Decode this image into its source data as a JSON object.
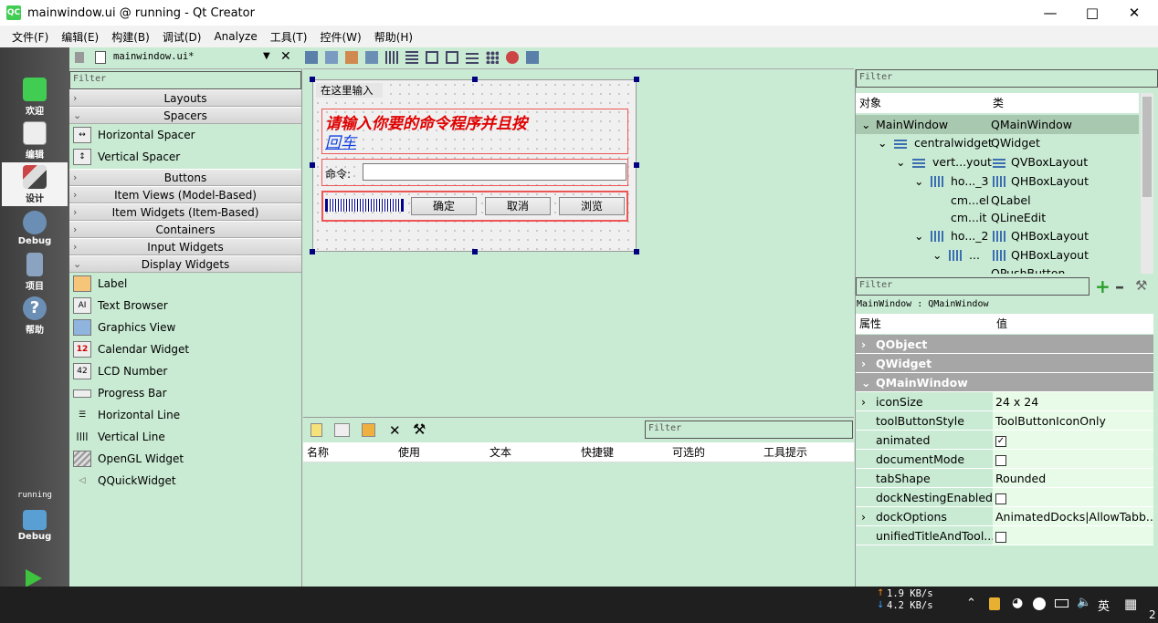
{
  "window": {
    "title": "mainwindow.ui @ running - Qt Creator",
    "logo": "QC"
  },
  "menu": [
    "文件(F)",
    "编辑(E)",
    "构建(B)",
    "调试(D)",
    "Analyze",
    "工具(T)",
    "控件(W)",
    "帮助(H)"
  ],
  "modes": [
    {
      "label": "欢迎",
      "icon": "qt-welcome-icon"
    },
    {
      "label": "编辑",
      "icon": "edit-icon"
    },
    {
      "label": "设计",
      "icon": "design-icon"
    },
    {
      "label": "Debug",
      "icon": "debug-icon"
    },
    {
      "label": "项目",
      "icon": "project-icon"
    },
    {
      "label": "帮助",
      "icon": "help-icon"
    }
  ],
  "run": {
    "kit_label": "running",
    "kit_mode": "Debug"
  },
  "editor": {
    "file_name": "mainwindow.ui*"
  },
  "widgetbox": {
    "filter_placeholder": "Filter",
    "categories_top": [
      "Layouts",
      "Spacers"
    ],
    "spacers": [
      "Horizontal Spacer",
      "Vertical Spacer"
    ],
    "categories_mid": [
      "Buttons",
      "Item Views (Model-Based)",
      "Item Widgets (Item-Based)",
      "Containers",
      "Input Widgets",
      "Display Widgets"
    ],
    "display_widgets": [
      "Label",
      "Text Browser",
      "Graphics View",
      "Calendar Widget",
      "LCD Number",
      "Progress Bar",
      "Horizontal Line",
      "Vertical Line",
      "OpenGL Widget",
      "QQuickWidget"
    ]
  },
  "form": {
    "menu_placeholder": "在这里输入",
    "label_text": "请输入你要的命令程序并且按",
    "label_link": "回车",
    "cmd_label": "命令:",
    "btn_ok": "确定",
    "btn_cancel": "取消",
    "btn_browse": "浏览"
  },
  "actions": {
    "filter_placeholder": "Filter",
    "columns": [
      "名称",
      "使用",
      "文本",
      "快捷键",
      "可选的",
      "工具提示"
    ]
  },
  "inspector": {
    "filter_placeholder": "Filter",
    "col_object": "对象",
    "col_class": "类",
    "rows": [
      {
        "obj": "MainWindow",
        "cls": "QMainWindow"
      },
      {
        "obj": "centralwidget",
        "cls": "QWidget"
      },
      {
        "obj": "vert...yout",
        "cls": "QVBoxLayout"
      },
      {
        "obj": "ho..._3",
        "cls": "QHBoxLayout"
      },
      {
        "obj": "cm...el",
        "cls": "QLabel"
      },
      {
        "obj": "cm...it",
        "cls": "QLineEdit"
      },
      {
        "obj": "ho..._2",
        "cls": "QHBoxLayout"
      },
      {
        "obj": "...",
        "cls": "QHBoxLayout"
      },
      {
        "obj": "",
        "cls": "QPushButton"
      }
    ]
  },
  "properties": {
    "filter_placeholder": "Filter",
    "context": "MainWindow : QMainWindow",
    "col_prop": "属性",
    "col_value": "值",
    "groups": [
      "QObject",
      "QWidget",
      "QMainWindow"
    ],
    "rows": [
      {
        "name": "iconSize",
        "value": "24 x 24"
      },
      {
        "name": "toolButtonStyle",
        "value": "ToolButtonIconOnly"
      },
      {
        "name": "animated",
        "value": ""
      },
      {
        "name": "documentMode",
        "value": ""
      },
      {
        "name": "tabShape",
        "value": "Rounded"
      },
      {
        "name": "dockNestingEnabled",
        "value": ""
      },
      {
        "name": "dockOptions",
        "value": "AnimatedDocks|AllowTabb..."
      },
      {
        "name": "unifiedTitleAndTool...",
        "value": ""
      }
    ]
  },
  "taskbar": {
    "upload": "1.9 KB/s",
    "download": "4.2 KB/s",
    "ime": "英",
    "clock_fragment": "2"
  },
  "colors": {
    "accent_green": "#c9ead3",
    "selection": "#a9c8b0",
    "group_grey": "#a6a6a6",
    "label_red": "#e00000"
  }
}
